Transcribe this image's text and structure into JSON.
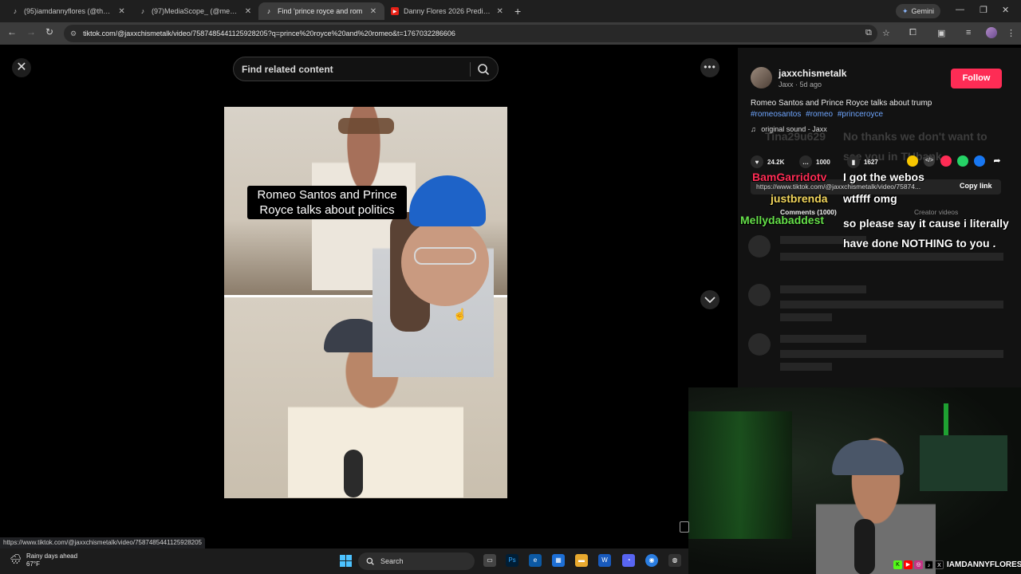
{
  "browser": {
    "tabs": [
      {
        "title": "(95)iamdannyflores (@theflore",
        "icon": "tiktok-icon",
        "active": false
      },
      {
        "title": "(97)MediaScope_ (@mediascop",
        "icon": "tiktok-icon",
        "active": false
      },
      {
        "title": "Find 'prince royce and rom",
        "icon": "tiktok-icon",
        "active": true
      },
      {
        "title": "Danny Flores 2026 Predictions",
        "icon": "youtube-icon",
        "active": false
      }
    ],
    "gemini_label": "Gemini",
    "url": "tiktok.com/@jaxxchismetalk/video/7587485441125928205?q=prince%20royce%20and%20romeo&t=1767032286606"
  },
  "viewer": {
    "search_placeholder": "Find related content",
    "caption": "Romeo Santos and Prince Royce talks about politics"
  },
  "panel": {
    "username": "jaxxchismetalk",
    "nickname": "Jaxx",
    "posted": "5d ago",
    "follow_label": "Follow",
    "description": "Romeo Santos and Prince Royce talks about trump",
    "hashtags": [
      "#romeosantos",
      "#romeo",
      "#princeroyce"
    ],
    "sound": "original sound - Jaxx",
    "likes": "24.2K",
    "comments": "1000",
    "saves": "1627",
    "copy_url": "https://www.tiktok.com/@jaxxchismetalk/video/75874...",
    "copy_link_label": "Copy link",
    "tab_comments": "Comments (1000)",
    "tab_creator": "Creator videos",
    "share_colors": [
      "#f7c600",
      "#3a3a3a",
      "#fe2c55",
      "#25d366",
      "#1877f2"
    ]
  },
  "chat": {
    "ghost_user": "Tina29u629",
    "ghost_msg_1": "No thanks we don't want to",
    "ghost_msg_2": "see you in ",
    "ghost_msg_2b": "TUbank",
    "messages": [
      {
        "user": "BamGarridotv",
        "color": "#ff2d55",
        "text": "I got the webos"
      },
      {
        "user": "justbrenda",
        "color": "#f2d65c",
        "text": "wtffff omg"
      },
      {
        "user": "Mellydabaddest",
        "color": "#66e04a",
        "text": "so please say it cause i literally have done NOTHING to you ."
      }
    ]
  },
  "status_url": "https://www.tiktok.com/@jaxxchismetalk/video/7587485441125928205",
  "webcam": {
    "handle": "IAMDANNYFLORES"
  },
  "taskbar": {
    "weather_title": "Rainy days ahead",
    "weather_temp": "67°F",
    "search_label": "Search"
  }
}
